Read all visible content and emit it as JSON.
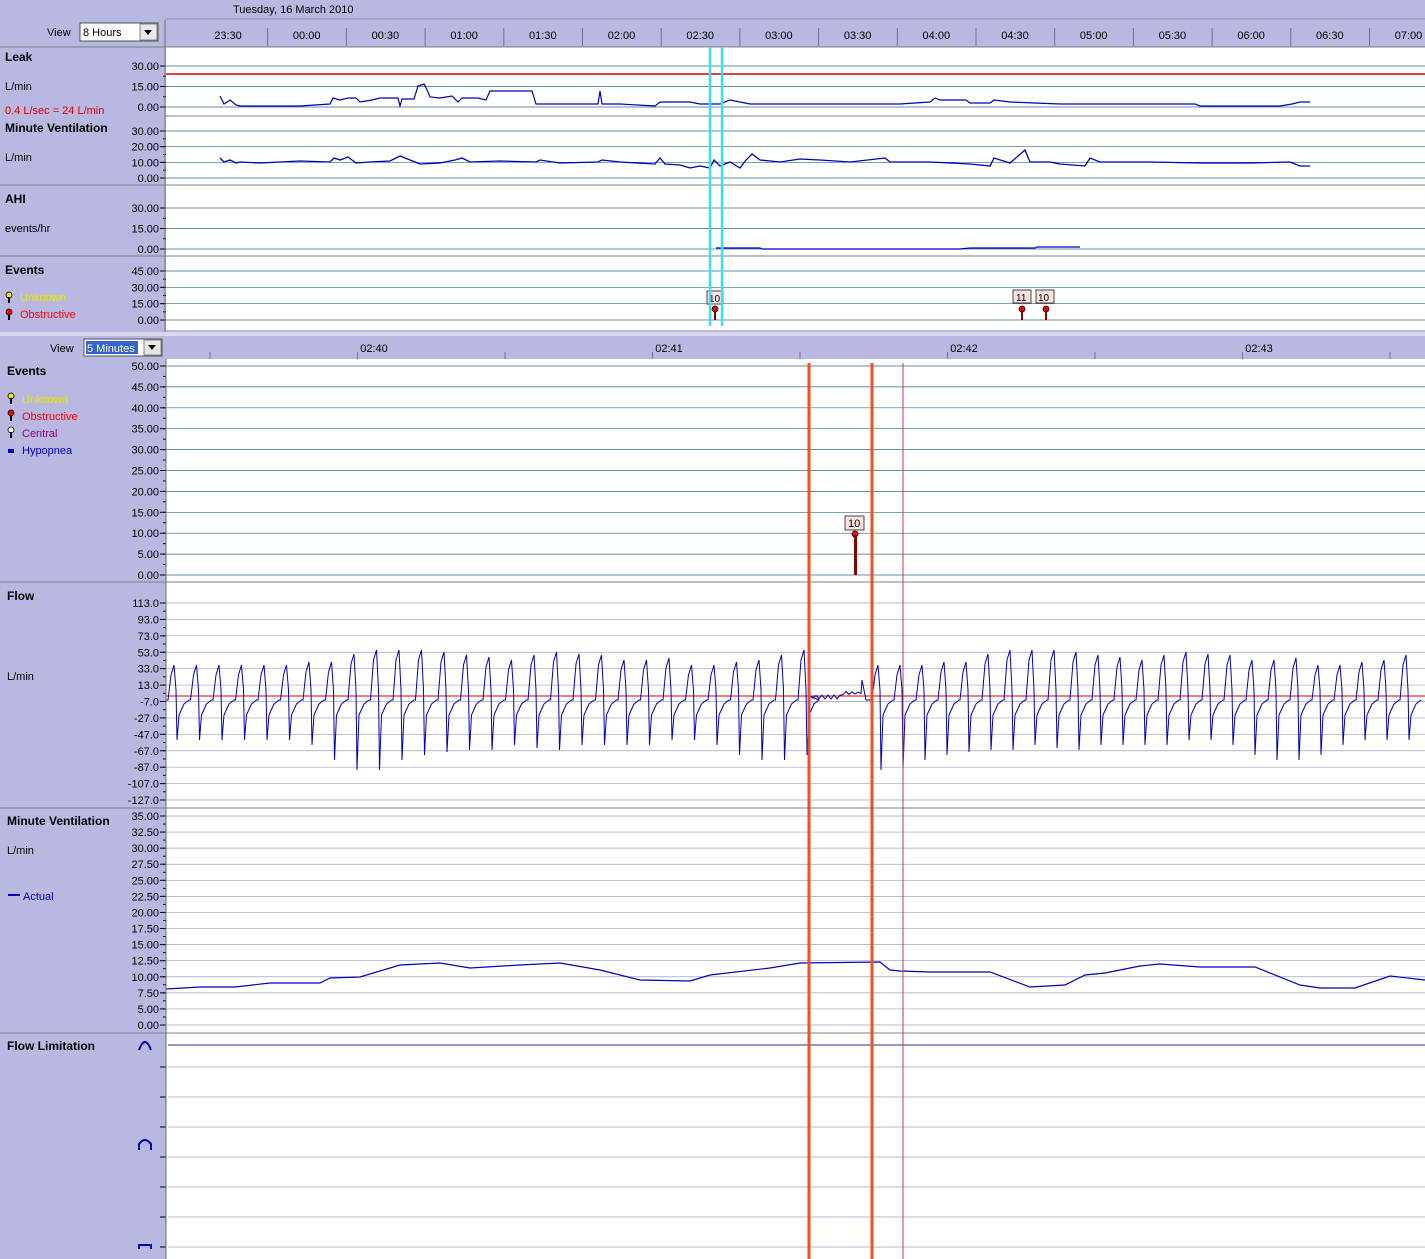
{
  "top": {
    "view_label": "View",
    "view_value": "8 Hours",
    "date": "Tuesday, 16 March 2010",
    "time_ticks": [
      "23:30",
      "00:00",
      "00:30",
      "01:00",
      "01:30",
      "02:00",
      "02:30",
      "03:00",
      "03:30",
      "04:00",
      "04:30",
      "05:00",
      "05:30",
      "06:00",
      "06:30",
      "07:00"
    ],
    "leak": {
      "title": "Leak",
      "unit": "L/min",
      "note": "0.4 L/sec = 24 L/min",
      "ticks": [
        "30.00",
        "15.00",
        "0.00"
      ],
      "threshold_color": "#d40000"
    },
    "minute_vent": {
      "title": "Minute Ventilation",
      "unit": "L/min",
      "ticks": [
        "30.00",
        "20.00",
        "10.00",
        "0.00"
      ]
    },
    "ahi": {
      "title": "AHI",
      "unit": "events/hr",
      "ticks": [
        "30.00",
        "15.00",
        "0.00"
      ]
    },
    "events": {
      "title": "Events",
      "ticks": [
        "45.00",
        "30.00",
        "15.00",
        "0.00"
      ],
      "legend": [
        {
          "label": "Unknown",
          "color": "#e8e800"
        },
        {
          "label": "Obstructive",
          "color": "#ff0000"
        }
      ],
      "markers": [
        "10",
        "11",
        "10"
      ]
    }
  },
  "bottom": {
    "view_label": "View",
    "view_value": "5 Minutes",
    "time_ticks": [
      "02:40",
      "02:41",
      "02:42",
      "02:43"
    ],
    "events": {
      "title": "Events",
      "ticks": [
        "50.00",
        "45.00",
        "40.00",
        "35.00",
        "30.00",
        "25.00",
        "20.00",
        "15.00",
        "10.00",
        "5.00",
        "0.00"
      ],
      "legend": [
        {
          "label": "Unknown",
          "color": "#e8e800"
        },
        {
          "label": "Obstructive",
          "color": "#ff0000"
        },
        {
          "label": "Central",
          "color": "#8b008b"
        },
        {
          "label": "Hypopnea",
          "color": "#0000cc"
        }
      ],
      "marker": "10"
    },
    "flow": {
      "title": "Flow",
      "unit": "L/min",
      "ticks": [
        "113.0",
        "93.0",
        "73.0",
        "53.0",
        "33.0",
        "13.0",
        "-7.0",
        "-27.0",
        "-47.0",
        "-67.0",
        "-87.0",
        "-107.0",
        "-127.0"
      ]
    },
    "minute_vent": {
      "title": "Minute Ventilation",
      "unit": "L/min",
      "legend": "Actual",
      "ticks": [
        "35.00",
        "32.50",
        "30.00",
        "27.50",
        "25.00",
        "22.50",
        "20.00",
        "17.50",
        "15.00",
        "12.50",
        "10.00",
        "7.50",
        "5.00",
        "0.00"
      ]
    },
    "flow_limitation": {
      "title": "Flow Limitation"
    }
  },
  "colors": {
    "panel": "#b8b8e0",
    "header": "#b8b8e0",
    "trace": "#0000bb",
    "grid": "#2e6e8e",
    "cursor_cyan": "#38e0f0",
    "event_line": "#f05020"
  }
}
